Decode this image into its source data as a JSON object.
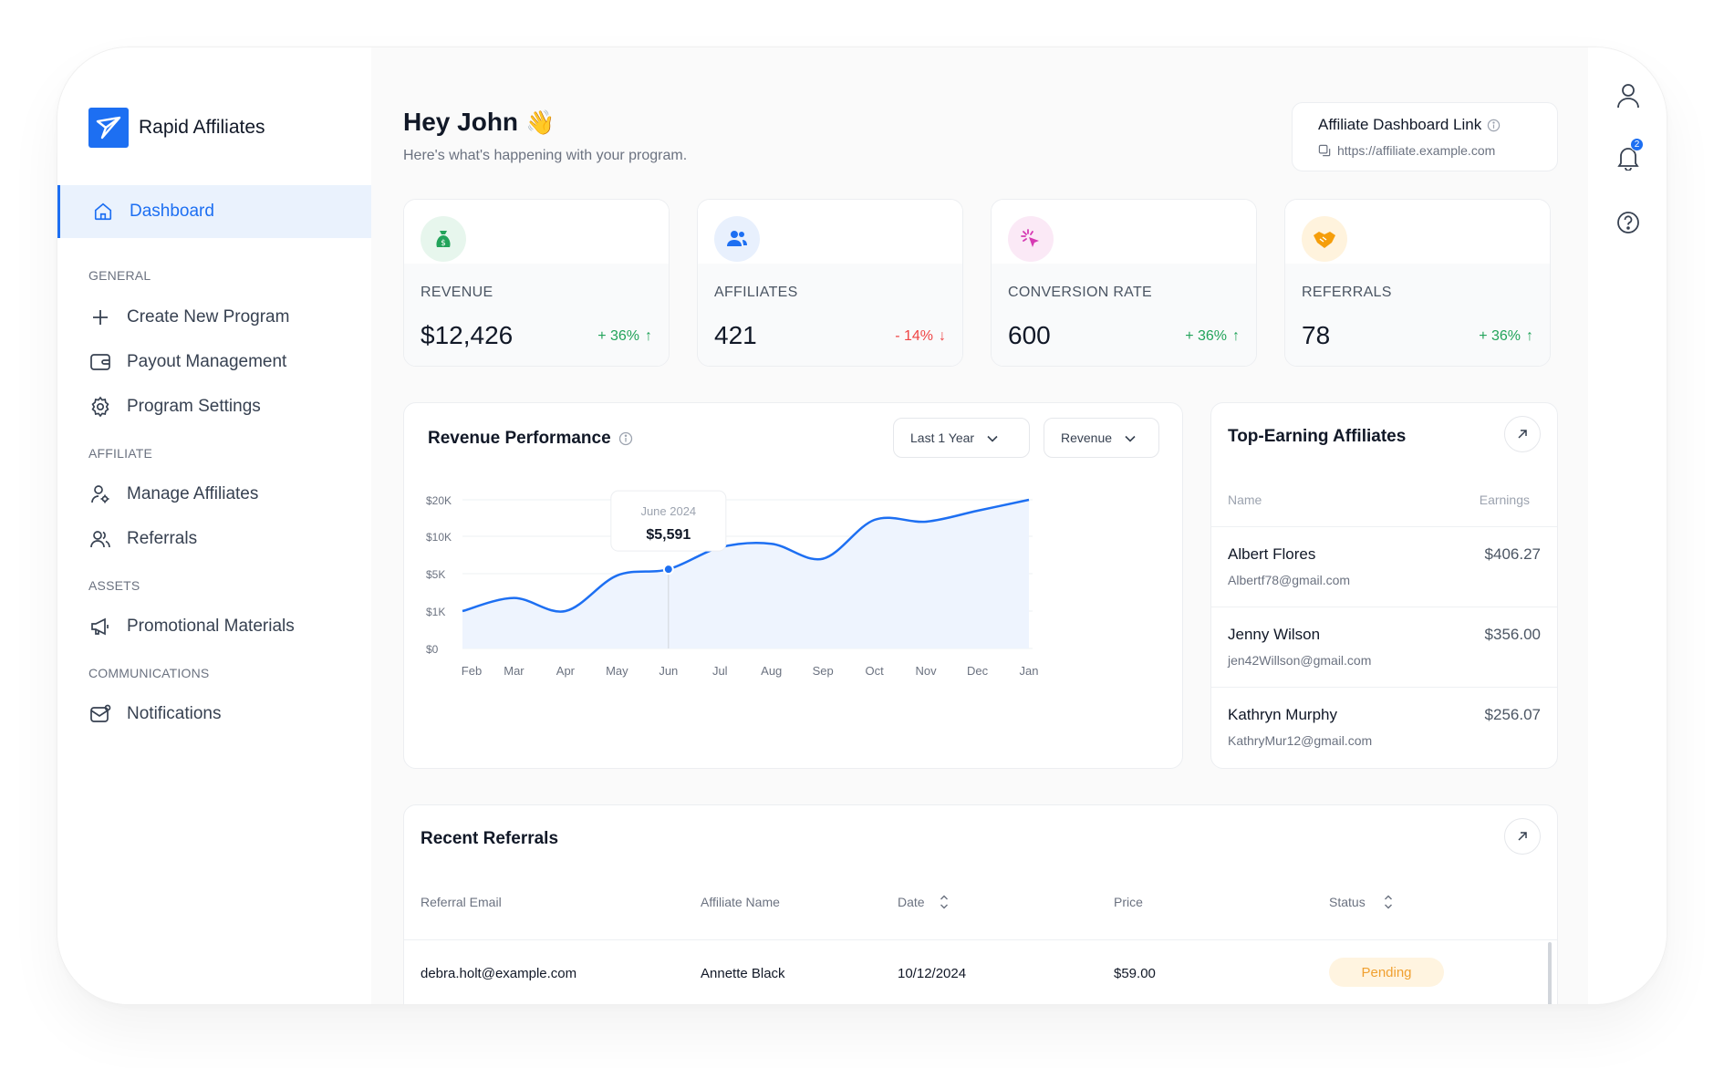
{
  "app": {
    "name": "Rapid Affiliates"
  },
  "sidebar": {
    "active": {
      "label": "Dashboard",
      "icon": "home-icon"
    },
    "sections": [
      {
        "heading": "GENERAL",
        "items": [
          {
            "label": "Create New Program",
            "icon": "plus-icon"
          },
          {
            "label": "Payout Management",
            "icon": "wallet-icon"
          },
          {
            "label": "Program Settings",
            "icon": "gear-icon"
          }
        ]
      },
      {
        "heading": "AFFILIATE",
        "items": [
          {
            "label": "Manage Affiliates",
            "icon": "user-gear-icon"
          },
          {
            "label": "Referrals",
            "icon": "users-icon"
          }
        ]
      },
      {
        "heading": "ASSETS",
        "items": [
          {
            "label": "Promotional Materials",
            "icon": "megaphone-icon"
          }
        ]
      },
      {
        "heading": "COMMUNICATIONS",
        "items": [
          {
            "label": "Notifications",
            "icon": "mail-notification-icon"
          }
        ]
      }
    ]
  },
  "header": {
    "greeting": "Hey John",
    "emoji": "👋",
    "subtitle": "Here's what's happening with your program.",
    "link_title": "Affiliate Dashboard Link",
    "link_url": "https://affiliate.example.com"
  },
  "stats": [
    {
      "label": "REVENUE",
      "value": "$12,426",
      "change": "+ 36%",
      "direction": "up",
      "icon": "money-bag-icon",
      "color": "#22a35a"
    },
    {
      "label": "AFFILIATES",
      "value": "421",
      "change": "- 14%",
      "direction": "down",
      "icon": "users-icon",
      "color": "#1d6ff2"
    },
    {
      "label": "CONVERSION RATE",
      "value": "600",
      "change": "+ 36%",
      "direction": "up",
      "icon": "cursor-click-icon",
      "color": "#d63ab3"
    },
    {
      "label": "REFERRALS",
      "value": "78",
      "change": "+ 36%",
      "direction": "up",
      "icon": "handshake-icon",
      "color": "#f59e0b"
    }
  ],
  "performance": {
    "title": "Revenue Performance",
    "range_select": "Last 1 Year",
    "metric_select": "Revenue",
    "tooltip": {
      "label": "June 2024",
      "value": "$5,591"
    }
  },
  "chart_data": {
    "type": "area",
    "title": "Revenue Performance",
    "categories": [
      "Feb",
      "Mar",
      "Apr",
      "May",
      "Jun",
      "Jul",
      "Aug",
      "Sep",
      "Oct",
      "Nov",
      "Dec",
      "Jan"
    ],
    "y_ticks": [
      "$20K",
      "$10K",
      "$5K",
      "$1K",
      "$0"
    ],
    "series": [
      {
        "values": [
          1000,
          2400,
          1000,
          4800,
          5591,
          8500,
          9000,
          7000,
          14500,
          14000,
          17000,
          20000
        ]
      }
    ],
    "grid": true,
    "highlight": {
      "category": "Jun",
      "value": 5591
    }
  },
  "top_affiliates": {
    "title": "Top-Earning Affiliates",
    "col_name": "Name",
    "col_earnings": "Earnings",
    "rows": [
      {
        "name": "Albert Flores",
        "email": "Albertf78@gmail.com",
        "earnings": "$406.27"
      },
      {
        "name": "Jenny Wilson",
        "email": "jen42Willson@gmail.com",
        "earnings": "$356.00"
      },
      {
        "name": "Kathryn Murphy",
        "email": "KathryMur12@gmail.com",
        "earnings": "$256.07"
      }
    ]
  },
  "recent": {
    "title": "Recent Referrals",
    "columns": [
      "Referral Email",
      "Affiliate Name",
      "Date",
      "Price",
      "Status"
    ],
    "rows": [
      {
        "email": "debra.holt@example.com",
        "affiliate": "Annette Black",
        "date": "10/12/2024",
        "price": "$59.00",
        "status": "Pending"
      }
    ]
  },
  "rightbar": {
    "notification_count": "2",
    "icons": [
      "profile-icon",
      "bell-icon",
      "help-icon"
    ]
  }
}
